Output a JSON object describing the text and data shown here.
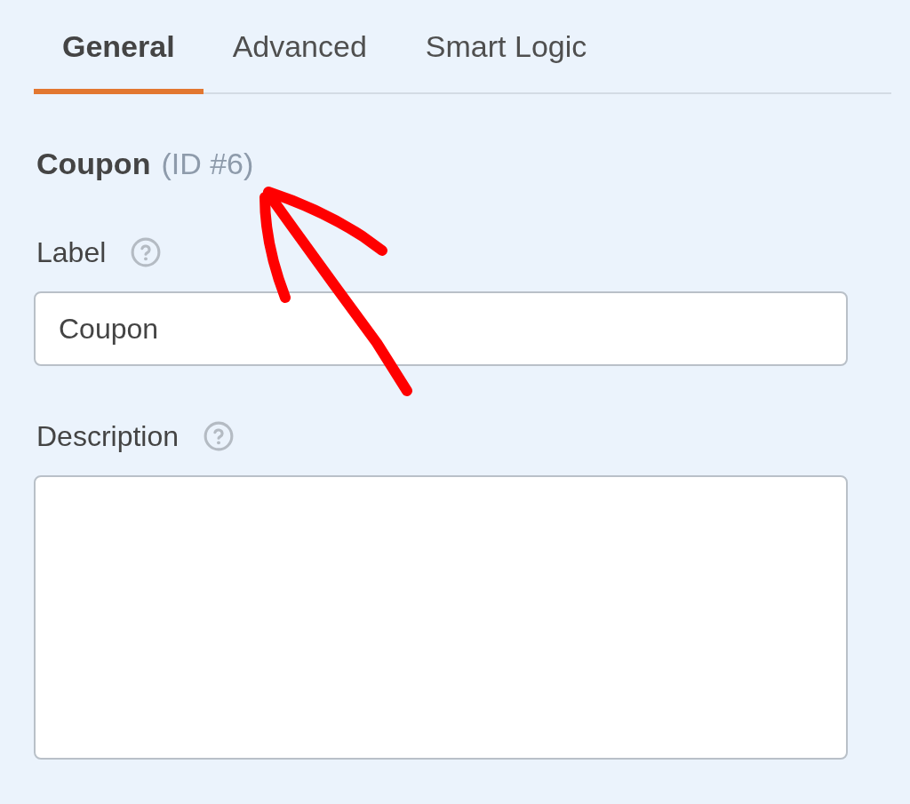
{
  "tabs": [
    {
      "label": "General",
      "selected": true
    },
    {
      "label": "Advanced",
      "selected": false
    },
    {
      "label": "Smart Logic",
      "selected": false
    }
  ],
  "field_heading": {
    "name": "Coupon",
    "id": "(ID #6)"
  },
  "fields": [
    {
      "kind": "input",
      "label": "Label",
      "value": "Coupon"
    },
    {
      "kind": "textarea",
      "label": "Description"
    }
  ]
}
